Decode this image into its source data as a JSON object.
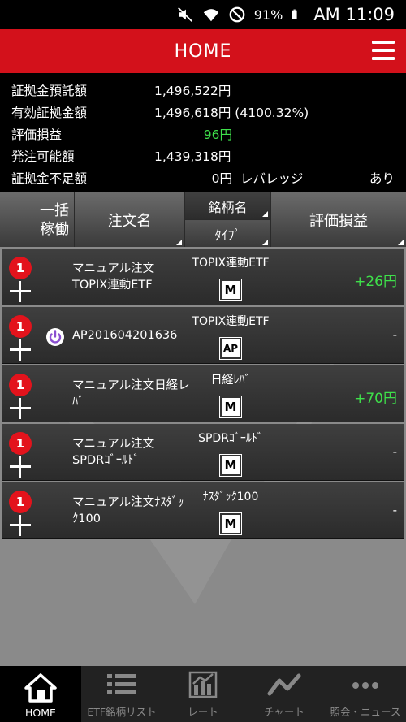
{
  "status_bar": {
    "battery": "91%",
    "time": "AM 11:09"
  },
  "header": {
    "title": "HOME"
  },
  "summary": {
    "margin_deposit_label": "証拠金預託額",
    "margin_deposit_value": "1,496,522円",
    "effective_margin_label": "有効証拠金額",
    "effective_margin_value": "1,496,618円 (4100.32%)",
    "valuation_label": "評価損益",
    "valuation_value": "96円",
    "orderable_label": "発注可能額",
    "orderable_value": "1,439,318円",
    "shortfall_label": "証拠金不足額",
    "shortfall_value": "0円",
    "leverage_label": "レバレッジ",
    "leverage_value": "あり"
  },
  "table_header": {
    "col_bulk": "一括\n稼働",
    "col_bulk_line1": "一括",
    "col_bulk_line2": "稼働",
    "col_order_name": "注文名",
    "col_symbol": "銘柄名",
    "col_type": "ﾀｲﾌﾟ",
    "col_pl": "評価損益"
  },
  "rows": [
    {
      "badge": "1",
      "name_line1": "マニュアル注文",
      "name_line2": "TOPIX連動ETF",
      "symbol": "TOPIX連動ETF",
      "type": "M",
      "pl": "+26円",
      "has_power": false
    },
    {
      "badge": "1",
      "name_line1": "AP201604201636",
      "name_line2": "",
      "symbol": "TOPIX連動ETF",
      "type": "AP",
      "pl": "-",
      "has_power": true
    },
    {
      "badge": "1",
      "name_line1": "マニュアル注文日経レ",
      "name_line2": "ﾊﾞ",
      "symbol": "日経ﾚﾊﾞ",
      "type": "M",
      "pl": "+70円",
      "has_power": false
    },
    {
      "badge": "1",
      "name_line1": "マニュアル注文",
      "name_line2": "SPDRｺﾞｰﾙﾄﾞ",
      "symbol": "SPDRｺﾞｰﾙﾄﾞ",
      "type": "M",
      "pl": "-",
      "has_power": false
    },
    {
      "badge": "1",
      "name_line1": "マニュアル注文ﾅｽﾀﾞｯ",
      "name_line2": "ｸ100",
      "symbol": "ﾅｽﾀﾞｯｸ100",
      "type": "M",
      "pl": "-",
      "has_power": false
    }
  ],
  "bottom_nav": [
    {
      "label": "HOME",
      "icon": "home-icon",
      "active": true
    },
    {
      "label": "ETF銘柄リスト",
      "icon": "list-icon",
      "active": false
    },
    {
      "label": "レート",
      "icon": "bar-chart-icon",
      "active": false
    },
    {
      "label": "チャート",
      "icon": "line-chart-icon",
      "active": false
    },
    {
      "label": "照会・ニュース",
      "icon": "more-icon",
      "active": false
    }
  ],
  "colors": {
    "header_red": "#d3111b",
    "positive_green": "#3ee04a",
    "badge_red": "#e3131c",
    "power_purple": "#8a4fd0"
  }
}
